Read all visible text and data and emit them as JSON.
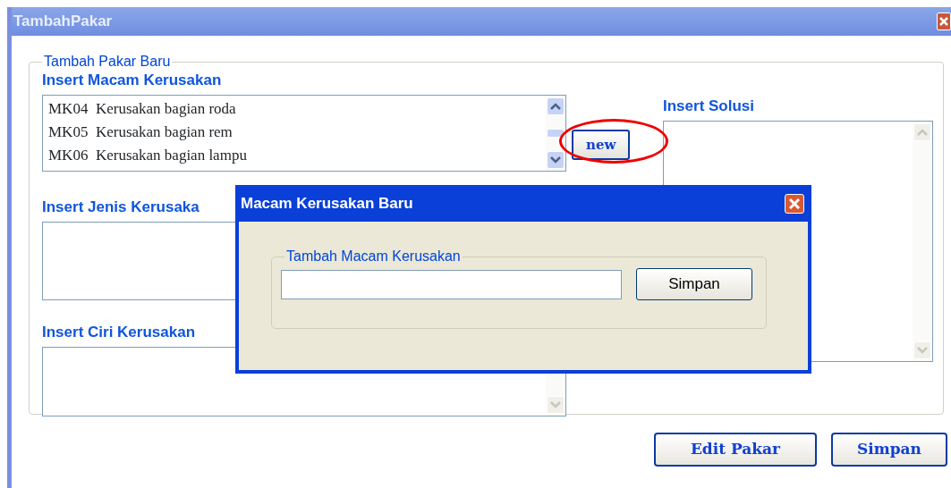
{
  "window": {
    "title": "TambahPakar"
  },
  "group": {
    "legend": "Tambah Pakar Baru"
  },
  "macam": {
    "label": "Insert Macam Kerusakan",
    "items": [
      {
        "code": "MK04",
        "name": "Kerusakan bagian roda"
      },
      {
        "code": "MK05",
        "name": "Kerusakan bagian rem"
      },
      {
        "code": "MK06",
        "name": "Kerusakan bagian lampu"
      }
    ]
  },
  "new_button": {
    "label": "new",
    "highlighted": true
  },
  "jenis": {
    "label": "Insert Jenis Kerusaka"
  },
  "ciri": {
    "label": "Insert Ciri Kerusakan"
  },
  "solusi": {
    "label": "Insert Solusi"
  },
  "buttons": [
    "Edit Pakar",
    "Simpan"
  ],
  "dialog": {
    "title": "Macam Kerusakan Baru",
    "legend": "Tambah Macam Kerusakan",
    "button": "Simpan"
  }
}
